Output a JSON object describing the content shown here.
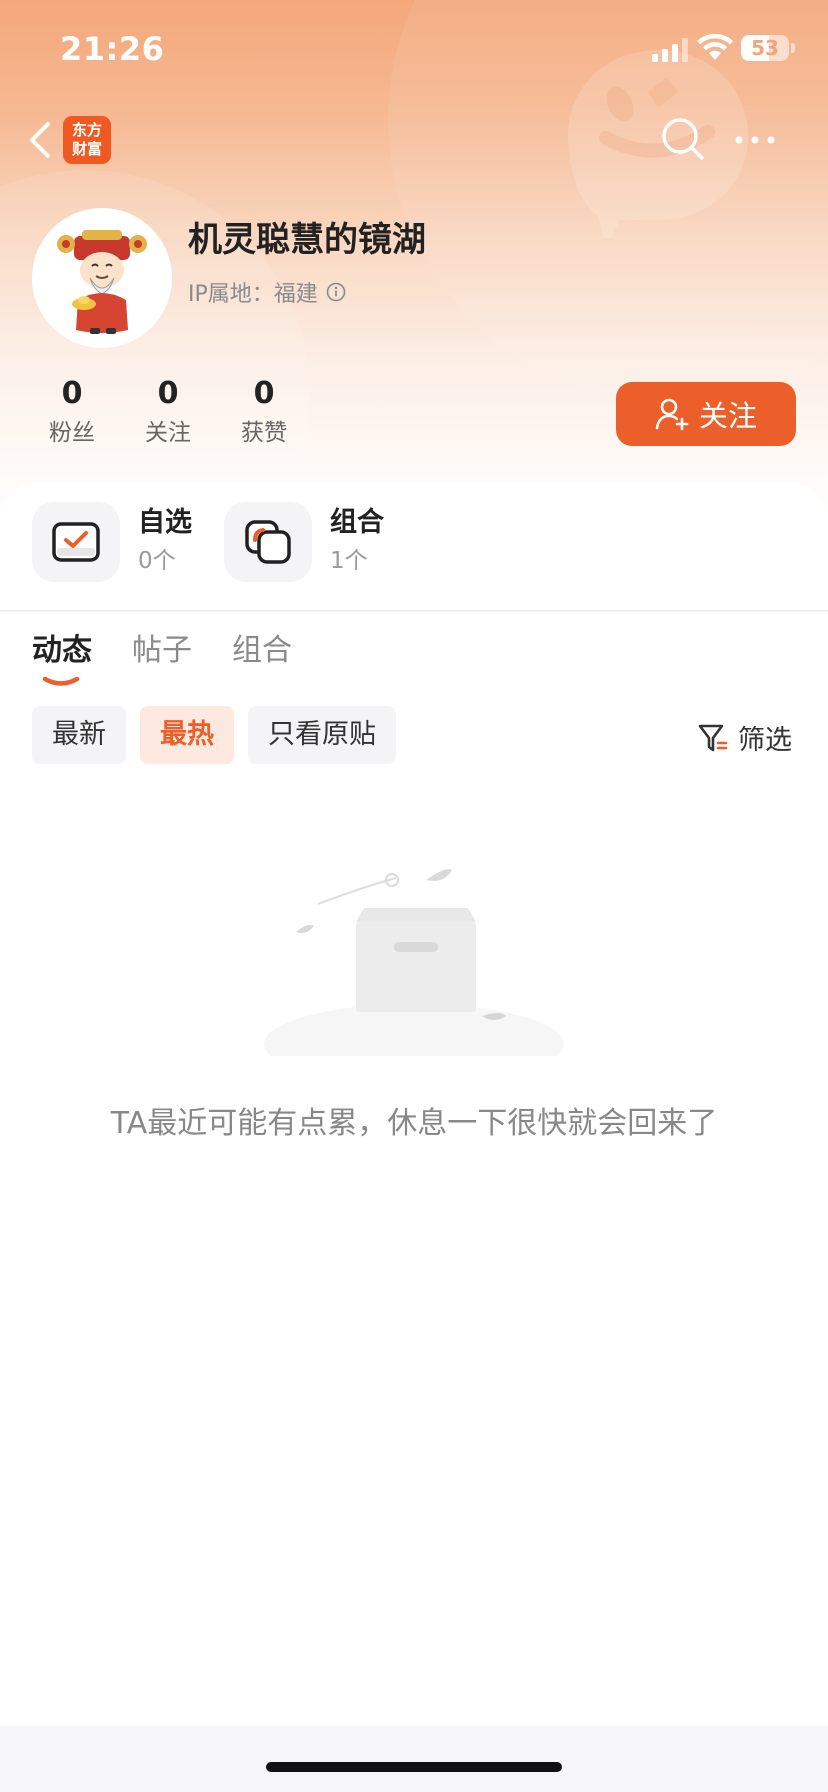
{
  "status_bar": {
    "time": "21:26",
    "battery": "53"
  },
  "app": {
    "logo_line1": "东方",
    "logo_line2": "财富",
    "brand_color": "#ec5e2a"
  },
  "profile": {
    "username": "机灵聪慧的镜湖",
    "ip_label": "IP属地：福建",
    "stats": [
      {
        "value": "0",
        "label": "粉丝"
      },
      {
        "value": "0",
        "label": "关注"
      },
      {
        "value": "0",
        "label": "获赞"
      }
    ],
    "follow_label": "关注"
  },
  "quick_links": [
    {
      "title": "自选",
      "sub": "0个",
      "icon": "watchlist-check-icon"
    },
    {
      "title": "组合",
      "sub": "1个",
      "icon": "portfolio-stack-icon"
    }
  ],
  "tabs": [
    {
      "label": "动态",
      "active": true
    },
    {
      "label": "帖子",
      "active": false
    },
    {
      "label": "组合",
      "active": false
    }
  ],
  "filters": {
    "chips": [
      {
        "label": "最新",
        "active": false
      },
      {
        "label": "最热",
        "active": true
      },
      {
        "label": "只看原贴",
        "active": false
      }
    ],
    "filter_label": "筛选"
  },
  "empty_state": {
    "message": "TA最近可能有点累，休息一下很快就会回来了"
  }
}
